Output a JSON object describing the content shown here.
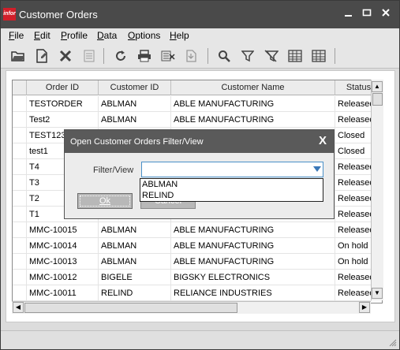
{
  "window": {
    "logo_text": "infor",
    "title": "Customer Orders",
    "min_icon": "—",
    "max_icon": "▭",
    "close_icon": "✕"
  },
  "menu": [
    "File",
    "Edit",
    "Profile",
    "Data",
    "Options",
    "Help"
  ],
  "menu_underline": [
    "F",
    "E",
    "P",
    "D",
    "O",
    "H"
  ],
  "toolbar_icons": [
    "open-folder-icon",
    "new-document-icon",
    "delete-icon",
    "list-icon",
    "refresh-icon",
    "print-icon",
    "export-icon",
    "import-icon",
    "search-icon",
    "filter-icon",
    "clear-filter-icon",
    "grid-icon",
    "grid-settings-icon"
  ],
  "grid": {
    "columns": [
      "Order ID",
      "Customer ID",
      "Customer Name",
      "Status"
    ],
    "rows": [
      [
        "TESTORDER",
        "ABLMAN",
        "ABLE MANUFACTURING",
        "Released"
      ],
      [
        "Test2",
        "ABLMAN",
        "ABLE MANUFACTURING",
        "Released"
      ],
      [
        "TEST123",
        "",
        "",
        "Closed"
      ],
      [
        "test1",
        "",
        "",
        "Closed"
      ],
      [
        "T4",
        "",
        "",
        "Released"
      ],
      [
        "T3",
        "",
        "",
        "Released"
      ],
      [
        "T2",
        "",
        "",
        "Released"
      ],
      [
        "T1",
        "",
        "",
        "Released"
      ],
      [
        "MMC-10015",
        "ABLMAN",
        "ABLE MANUFACTURING",
        "Released"
      ],
      [
        "MMC-10014",
        "ABLMAN",
        "ABLE MANUFACTURING",
        "On hold"
      ],
      [
        "MMC-10013",
        "ABLMAN",
        "ABLE MANUFACTURING",
        "On hold"
      ],
      [
        "MMC-10012",
        "BIGELE",
        "BIGSKY ELECTRONICS",
        "Released"
      ],
      [
        "MMC-10011",
        "RELIND",
        "RELIANCE INDUSTRIES",
        "Released"
      ]
    ]
  },
  "dialog": {
    "title": "Open Customer Orders Filter/View",
    "close": "X",
    "field_label": "Filter/View",
    "field_value": "",
    "options": [
      "ABLMAN",
      "RELIND"
    ],
    "ok_label": "Ok",
    "cancel_label": "Cancel"
  }
}
